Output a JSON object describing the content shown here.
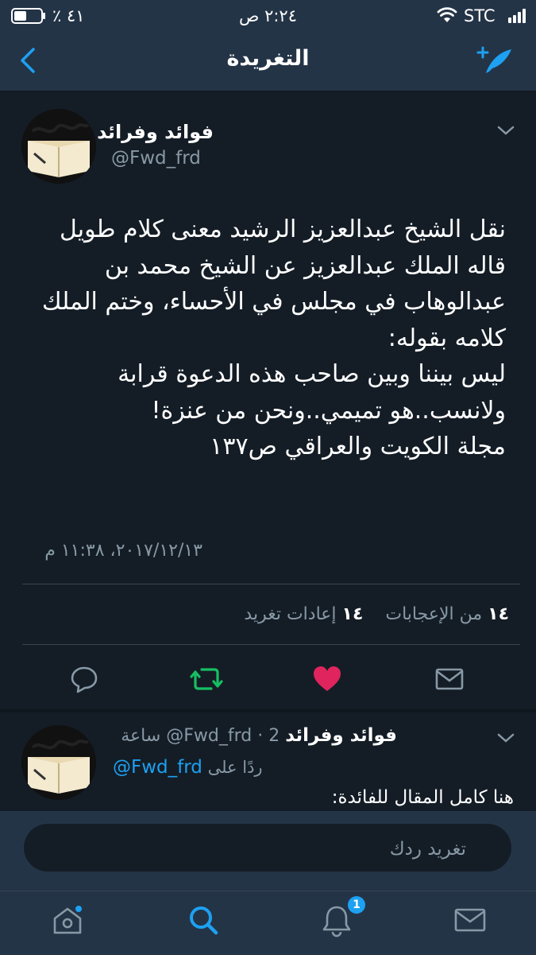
{
  "status_bar": {
    "carrier": "STC",
    "time": "٢:٢٤ ص",
    "battery_percent": "٤١ ٪"
  },
  "header": {
    "title": "التغريدة"
  },
  "tweet": {
    "author_name": "فوائد وفرائد",
    "author_handle": "@Fwd_frd",
    "text_lines": [
      "نقل الشيخ عبدالعزيز الرشيد معنى كلام طويل",
      "قاله الملك عبدالعزيز عن الشيخ محمد بن",
      "عبدالوهاب في مجلس في الأحساء، وختم الملك",
      "كلامه بقوله:",
      "ليس بيننا وبين صاحب هذه الدعوة قرابة",
      "ولانسب..هو تميمي..ونحن من عنزة!",
      "مجلة الكويت والعراقي ص١٣٧"
    ],
    "timestamp": "٢٠١٧/١٢/١٣، ١١:٣٨ م",
    "likes_count": "١٤",
    "likes_label": "من الإعجابات",
    "retweets_count": "١٤",
    "retweets_label": "إعادات تغريد",
    "actions": {
      "reply": "reply-icon",
      "retweet": "retweet-icon",
      "like": "heart-icon",
      "message": "mail-icon"
    },
    "colors": {
      "retweet": "#17bf63",
      "like": "#e0245e"
    }
  },
  "reply": {
    "author_name": "فوائد وفرائد",
    "author_handle": "@Fwd_frd",
    "time_ago": "2 ساعة",
    "replying_to_label": "ردًا على",
    "replying_to_handle": "@Fwd_frd",
    "text": "هنا كامل المقال للفائدة:"
  },
  "composer": {
    "placeholder": "تغريد ردك"
  },
  "tab_bar": {
    "tabs": [
      "home-icon",
      "search-icon",
      "notifications-icon",
      "messages-icon"
    ],
    "notifications_badge": "1"
  },
  "colors": {
    "accent": "#1da1f2",
    "background": "#141d26",
    "bar": "#243447",
    "muted": "#8899a6"
  }
}
